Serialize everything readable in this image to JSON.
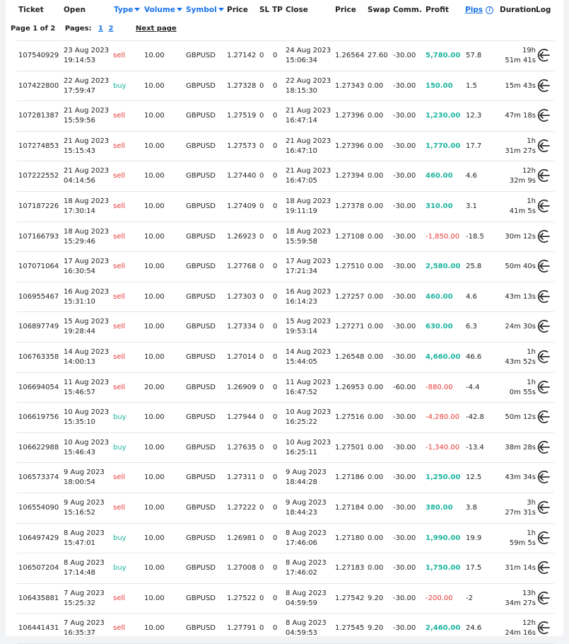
{
  "headers": {
    "ticket": "Ticket",
    "open": "Open",
    "type": "Type",
    "volume": "Volume",
    "symbol": "Symbol",
    "price": "Price",
    "sl": "SL",
    "tp": "TP",
    "close": "Close",
    "close_price": "Price",
    "swap": "Swap",
    "comm": "Comm.",
    "profit": "Profit",
    "pips": "Pips",
    "duration": "Duration",
    "log": "Log"
  },
  "pagination": {
    "info": "Page 1 of 2",
    "pages_label": "Pages:",
    "pages": [
      "1",
      "2"
    ],
    "next": "Next page"
  },
  "colors": {
    "sell": "#e53935",
    "buy": "#1cb5a0",
    "positive": "#1cb5a0",
    "negative": "#e53935",
    "link": "#1a73e8"
  },
  "trades": [
    {
      "ticket": "107540929",
      "open_date": "23 Aug 2023",
      "open_time": "19:14:53",
      "type": "sell",
      "volume": "10.00",
      "symbol": "GBPUSD",
      "price": "1.27142",
      "sl": "0",
      "tp": "0",
      "close_date": "24 Aug 2023",
      "close_time": "15:06:34",
      "close_price": "1.26564",
      "swap": "27.60",
      "comm": "-30.00",
      "profit": "5,780.00",
      "pips": "57.8",
      "dur1": "19h",
      "dur2": "51m 41s"
    },
    {
      "ticket": "107422800",
      "open_date": "22 Aug 2023",
      "open_time": "17:59:47",
      "type": "buy",
      "volume": "10.00",
      "symbol": "GBPUSD",
      "price": "1.27328",
      "sl": "0",
      "tp": "0",
      "close_date": "22 Aug 2023",
      "close_time": "18:15:30",
      "close_price": "1.27343",
      "swap": "0.00",
      "comm": "-30.00",
      "profit": "150.00",
      "pips": "1.5",
      "dur1": "15m 43s",
      "dur2": ""
    },
    {
      "ticket": "107281387",
      "open_date": "21 Aug 2023",
      "open_time": "15:59:56",
      "type": "sell",
      "volume": "10.00",
      "symbol": "GBPUSD",
      "price": "1.27519",
      "sl": "0",
      "tp": "0",
      "close_date": "21 Aug 2023",
      "close_time": "16:47:14",
      "close_price": "1.27396",
      "swap": "0.00",
      "comm": "-30.00",
      "profit": "1,230.00",
      "pips": "12.3",
      "dur1": "47m 18s",
      "dur2": ""
    },
    {
      "ticket": "107274853",
      "open_date": "21 Aug 2023",
      "open_time": "15:15:43",
      "type": "sell",
      "volume": "10.00",
      "symbol": "GBPUSD",
      "price": "1.27573",
      "sl": "0",
      "tp": "0",
      "close_date": "21 Aug 2023",
      "close_time": "16:47:10",
      "close_price": "1.27396",
      "swap": "0.00",
      "comm": "-30.00",
      "profit": "1,770.00",
      "pips": "17.7",
      "dur1": "1h",
      "dur2": "31m 27s"
    },
    {
      "ticket": "107222552",
      "open_date": "21 Aug 2023",
      "open_time": "04:14:56",
      "type": "sell",
      "volume": "10.00",
      "symbol": "GBPUSD",
      "price": "1.27440",
      "sl": "0",
      "tp": "0",
      "close_date": "21 Aug 2023",
      "close_time": "16:47:05",
      "close_price": "1.27394",
      "swap": "0.00",
      "comm": "-30.00",
      "profit": "460.00",
      "pips": "4.6",
      "dur1": "12h",
      "dur2": "32m 9s"
    },
    {
      "ticket": "107187226",
      "open_date": "18 Aug 2023",
      "open_time": "17:30:14",
      "type": "sell",
      "volume": "10.00",
      "symbol": "GBPUSD",
      "price": "1.27409",
      "sl": "0",
      "tp": "0",
      "close_date": "18 Aug 2023",
      "close_time": "19:11:19",
      "close_price": "1.27378",
      "swap": "0.00",
      "comm": "-30.00",
      "profit": "310.00",
      "pips": "3.1",
      "dur1": "1h",
      "dur2": "41m 5s"
    },
    {
      "ticket": "107166793",
      "open_date": "18 Aug 2023",
      "open_time": "15:29:46",
      "type": "sell",
      "volume": "10.00",
      "symbol": "GBPUSD",
      "price": "1.26923",
      "sl": "0",
      "tp": "0",
      "close_date": "18 Aug 2023",
      "close_time": "15:59:58",
      "close_price": "1.27108",
      "swap": "0.00",
      "comm": "-30.00",
      "profit": "-1,850.00",
      "pips": "-18.5",
      "dur1": "30m 12s",
      "dur2": ""
    },
    {
      "ticket": "107071064",
      "open_date": "17 Aug 2023",
      "open_time": "16:30:54",
      "type": "sell",
      "volume": "10.00",
      "symbol": "GBPUSD",
      "price": "1.27768",
      "sl": "0",
      "tp": "0",
      "close_date": "17 Aug 2023",
      "close_time": "17:21:34",
      "close_price": "1.27510",
      "swap": "0.00",
      "comm": "-30.00",
      "profit": "2,580.00",
      "pips": "25.8",
      "dur1": "50m 40s",
      "dur2": ""
    },
    {
      "ticket": "106955467",
      "open_date": "16 Aug 2023",
      "open_time": "15:31:10",
      "type": "sell",
      "volume": "10.00",
      "symbol": "GBPUSD",
      "price": "1.27303",
      "sl": "0",
      "tp": "0",
      "close_date": "16 Aug 2023",
      "close_time": "16:14:23",
      "close_price": "1.27257",
      "swap": "0.00",
      "comm": "-30.00",
      "profit": "460.00",
      "pips": "4.6",
      "dur1": "43m 13s",
      "dur2": ""
    },
    {
      "ticket": "106897749",
      "open_date": "15 Aug 2023",
      "open_time": "19:28:44",
      "type": "sell",
      "volume": "10.00",
      "symbol": "GBPUSD",
      "price": "1.27334",
      "sl": "0",
      "tp": "0",
      "close_date": "15 Aug 2023",
      "close_time": "19:53:14",
      "close_price": "1.27271",
      "swap": "0.00",
      "comm": "-30.00",
      "profit": "630.00",
      "pips": "6.3",
      "dur1": "24m 30s",
      "dur2": ""
    },
    {
      "ticket": "106763358",
      "open_date": "14 Aug 2023",
      "open_time": "14:00:13",
      "type": "sell",
      "volume": "10.00",
      "symbol": "GBPUSD",
      "price": "1.27014",
      "sl": "0",
      "tp": "0",
      "close_date": "14 Aug 2023",
      "close_time": "15:44:05",
      "close_price": "1.26548",
      "swap": "0.00",
      "comm": "-30.00",
      "profit": "4,660.00",
      "pips": "46.6",
      "dur1": "1h",
      "dur2": "43m 52s"
    },
    {
      "ticket": "106694054",
      "open_date": "11 Aug 2023",
      "open_time": "15:46:57",
      "type": "sell",
      "volume": "20.00",
      "symbol": "GBPUSD",
      "price": "1.26909",
      "sl": "0",
      "tp": "0",
      "close_date": "11 Aug 2023",
      "close_time": "16:47:52",
      "close_price": "1.26953",
      "swap": "0.00",
      "comm": "-60.00",
      "profit": "-880.00",
      "pips": "-4.4",
      "dur1": "1h",
      "dur2": "0m 55s"
    },
    {
      "ticket": "106619756",
      "open_date": "10 Aug 2023",
      "open_time": "15:35:10",
      "type": "buy",
      "volume": "10.00",
      "symbol": "GBPUSD",
      "price": "1.27944",
      "sl": "0",
      "tp": "0",
      "close_date": "10 Aug 2023",
      "close_time": "16:25:22",
      "close_price": "1.27516",
      "swap": "0.00",
      "comm": "-30.00",
      "profit": "-4,280.00",
      "pips": "-42.8",
      "dur1": "50m 12s",
      "dur2": ""
    },
    {
      "ticket": "106622988",
      "open_date": "10 Aug 2023",
      "open_time": "15:46:43",
      "type": "buy",
      "volume": "10.00",
      "symbol": "GBPUSD",
      "price": "1.27635",
      "sl": "0",
      "tp": "0",
      "close_date": "10 Aug 2023",
      "close_time": "16:25:11",
      "close_price": "1.27501",
      "swap": "0.00",
      "comm": "-30.00",
      "profit": "-1,340.00",
      "pips": "-13.4",
      "dur1": "38m 28s",
      "dur2": ""
    },
    {
      "ticket": "106573374",
      "open_date": "9 Aug 2023",
      "open_time": "18:00:54",
      "type": "sell",
      "volume": "10.00",
      "symbol": "GBPUSD",
      "price": "1.27311",
      "sl": "0",
      "tp": "0",
      "close_date": "9 Aug 2023",
      "close_time": "18:44:28",
      "close_price": "1.27186",
      "swap": "0.00",
      "comm": "-30.00",
      "profit": "1,250.00",
      "pips": "12.5",
      "dur1": "43m 34s",
      "dur2": ""
    },
    {
      "ticket": "106554090",
      "open_date": "9 Aug 2023",
      "open_time": "15:16:52",
      "type": "sell",
      "volume": "10.00",
      "symbol": "GBPUSD",
      "price": "1.27222",
      "sl": "0",
      "tp": "0",
      "close_date": "9 Aug 2023",
      "close_time": "18:44:23",
      "close_price": "1.27184",
      "swap": "0.00",
      "comm": "-30.00",
      "profit": "380.00",
      "pips": "3.8",
      "dur1": "3h",
      "dur2": "27m 31s"
    },
    {
      "ticket": "106497429",
      "open_date": "8 Aug 2023",
      "open_time": "15:47:01",
      "type": "buy",
      "volume": "10.00",
      "symbol": "GBPUSD",
      "price": "1.26981",
      "sl": "0",
      "tp": "0",
      "close_date": "8 Aug 2023",
      "close_time": "17:46:06",
      "close_price": "1.27180",
      "swap": "0.00",
      "comm": "-30.00",
      "profit": "1,990.00",
      "pips": "19.9",
      "dur1": "1h",
      "dur2": "59m 5s"
    },
    {
      "ticket": "106507204",
      "open_date": "8 Aug 2023",
      "open_time": "17:14:48",
      "type": "buy",
      "volume": "10.00",
      "symbol": "GBPUSD",
      "price": "1.27008",
      "sl": "0",
      "tp": "0",
      "close_date": "8 Aug 2023",
      "close_time": "17:46:02",
      "close_price": "1.27183",
      "swap": "0.00",
      "comm": "-30.00",
      "profit": "1,750.00",
      "pips": "17.5",
      "dur1": "31m 14s",
      "dur2": ""
    },
    {
      "ticket": "106435881",
      "open_date": "7 Aug 2023",
      "open_time": "15:25:32",
      "type": "sell",
      "volume": "10.00",
      "symbol": "GBPUSD",
      "price": "1.27522",
      "sl": "0",
      "tp": "0",
      "close_date": "8 Aug 2023",
      "close_time": "04:59:59",
      "close_price": "1.27542",
      "swap": "9.20",
      "comm": "-30.00",
      "profit": "-200.00",
      "pips": "-2",
      "dur1": "13h",
      "dur2": "34m 27s"
    },
    {
      "ticket": "106441431",
      "open_date": "7 Aug 2023",
      "open_time": "16:35:37",
      "type": "sell",
      "volume": "10.00",
      "symbol": "GBPUSD",
      "price": "1.27791",
      "sl": "0",
      "tp": "0",
      "close_date": "8 Aug 2023",
      "close_time": "04:59:53",
      "close_price": "1.27545",
      "swap": "9.20",
      "comm": "-30.00",
      "profit": "2,460.00",
      "pips": "24.6",
      "dur1": "12h",
      "dur2": "24m 16s"
    }
  ]
}
